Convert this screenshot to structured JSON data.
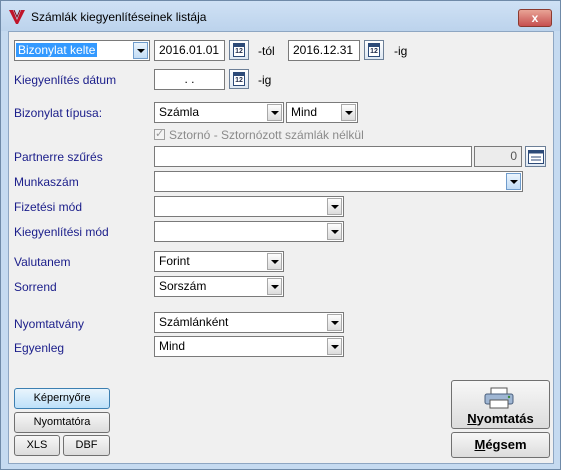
{
  "window": {
    "title": "Számlák kiegyenlítéseinek listája",
    "close_label": "x"
  },
  "date_filter": {
    "type_selected": "Bizonylat kelte",
    "from": "2016.01.01",
    "from_suffix": "-tól",
    "to": "2016.12.31",
    "to_suffix": "-ig",
    "calendar_text": "12"
  },
  "settlement_date": {
    "label": "Kiegyenlítés dátum",
    "value": " . .",
    "suffix": "-ig"
  },
  "doc_type": {
    "label": "Bizonylat típusa:",
    "value": "Számla",
    "scope": "Mind"
  },
  "storno": {
    "checked": true,
    "label": "Sztornó - Sztornózott számlák nélkül"
  },
  "partner": {
    "label": "Partnerre szűrés",
    "value": "",
    "count": "0"
  },
  "job_number": {
    "label": "Munkaszám",
    "value": ""
  },
  "payment_method": {
    "label": "Fizetési mód",
    "value": ""
  },
  "settlement_method": {
    "label": "Kiegyenlítési mód",
    "value": ""
  },
  "currency": {
    "label": "Valutanem",
    "value": "Forint"
  },
  "sort": {
    "label": "Sorrend",
    "value": "Sorszám"
  },
  "form_type": {
    "label": "Nyomtatvány",
    "value": "Számlánként"
  },
  "balance": {
    "label": "Egyenleg",
    "value": "Mind"
  },
  "output": {
    "screen": "Képernyőre",
    "printer": "Nyomtatóra",
    "xls": "XLS",
    "dbf": "DBF"
  },
  "actions": {
    "print_ul": "N",
    "print_rest": "yomtatás",
    "cancel_ul": "M",
    "cancel_rest": "égsem"
  },
  "colors": {
    "label": "#1a1d8a",
    "accent": "#3399ff",
    "title_bg": "#c5daf0"
  }
}
